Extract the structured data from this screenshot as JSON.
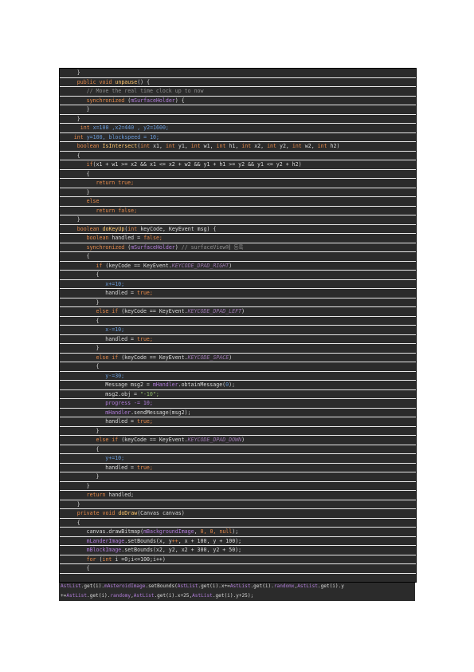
{
  "colors": {
    "background": "#2b2b2b",
    "keyword": "#e4894a",
    "method": "#ffc66d",
    "field": "#b07cd8",
    "constant": "#9876aa",
    "comment": "#8c8c8c",
    "number": "#6a9bd8",
    "string": "#8fb86a",
    "text": "#d8d8d8"
  },
  "lines": [
    {
      "indent": 5,
      "tokens": [
        {
          "t": "}",
          "c": "pl"
        }
      ]
    },
    {
      "indent": 5,
      "tokens": [
        {
          "t": "public void ",
          "c": "kw"
        },
        {
          "t": "unpause",
          "c": "fn"
        },
        {
          "t": "() {",
          "c": "pl"
        }
      ]
    },
    {
      "indent": 8,
      "tokens": [
        {
          "t": "// Move the real time clock up to now",
          "c": "com"
        }
      ]
    },
    {
      "indent": 8,
      "tokens": [
        {
          "t": "synchronized ",
          "c": "kw"
        },
        {
          "t": "(",
          "c": "pl"
        },
        {
          "t": "mSurfaceHolder",
          "c": "fld"
        },
        {
          "t": ") {",
          "c": "pl"
        }
      ]
    },
    {
      "indent": 8,
      "tokens": [
        {
          "t": "}",
          "c": "pl"
        }
      ]
    },
    {
      "indent": 5,
      "tokens": [
        {
          "t": "}",
          "c": "pl"
        }
      ]
    },
    {
      "indent": 5,
      "tokens": [
        {
          "t": " int ",
          "c": "kw"
        },
        {
          "t": "x=100 ,x2=440 , y2=1600;",
          "c": "num"
        }
      ]
    },
    {
      "indent": 4,
      "tokens": [
        {
          "t": "int ",
          "c": "kw"
        },
        {
          "t": "y=100, blockspeed = 10;",
          "c": "num"
        }
      ]
    },
    {
      "indent": 5,
      "tokens": [
        {
          "t": "boolean ",
          "c": "kw"
        },
        {
          "t": "IsIntersect",
          "c": "fn"
        },
        {
          "t": "(",
          "c": "pl"
        },
        {
          "t": "int ",
          "c": "kw"
        },
        {
          "t": "x1, ",
          "c": "pl"
        },
        {
          "t": "int ",
          "c": "kw"
        },
        {
          "t": "y1, ",
          "c": "pl"
        },
        {
          "t": "int ",
          "c": "kw"
        },
        {
          "t": "w1, ",
          "c": "pl"
        },
        {
          "t": "int ",
          "c": "kw"
        },
        {
          "t": "h1, ",
          "c": "pl"
        },
        {
          "t": "int ",
          "c": "kw"
        },
        {
          "t": "x2, ",
          "c": "pl"
        },
        {
          "t": "int ",
          "c": "kw"
        },
        {
          "t": "y2, ",
          "c": "pl"
        },
        {
          "t": "int ",
          "c": "kw"
        },
        {
          "t": "w2, ",
          "c": "pl"
        },
        {
          "t": "int ",
          "c": "kw"
        },
        {
          "t": "h2)",
          "c": "pl"
        }
      ]
    },
    {
      "indent": 5,
      "tokens": [
        {
          "t": "{",
          "c": "pl"
        }
      ]
    },
    {
      "indent": 8,
      "tokens": [
        {
          "t": "if",
          "c": "kw"
        },
        {
          "t": "(x1 + w1 >= x2 && x1 <= x2 + w2 && y1 + h1 >= y2 && y1 <= y2 + h2)",
          "c": "pl"
        }
      ]
    },
    {
      "indent": 8,
      "tokens": [
        {
          "t": "{",
          "c": "pl"
        }
      ]
    },
    {
      "indent": 11,
      "tokens": [
        {
          "t": "return true;",
          "c": "kw"
        }
      ]
    },
    {
      "indent": 8,
      "tokens": [
        {
          "t": "}",
          "c": "pl"
        }
      ]
    },
    {
      "indent": 8,
      "tokens": [
        {
          "t": "else",
          "c": "kw"
        }
      ]
    },
    {
      "indent": 11,
      "tokens": [
        {
          "t": "return false;",
          "c": "kw"
        }
      ]
    },
    {
      "indent": 5,
      "tokens": [
        {
          "t": "}",
          "c": "pl"
        }
      ]
    },
    {
      "indent": 5,
      "tokens": [
        {
          "t": "boolean ",
          "c": "kw"
        },
        {
          "t": "doKeyUp",
          "c": "fn"
        },
        {
          "t": "(",
          "c": "pl"
        },
        {
          "t": "int ",
          "c": "kw"
        },
        {
          "t": "keyCode, KeyEvent msg) {",
          "c": "pl"
        }
      ]
    },
    {
      "indent": 8,
      "tokens": [
        {
          "t": "boolean ",
          "c": "kw"
        },
        {
          "t": "handled = ",
          "c": "pl"
        },
        {
          "t": "false;",
          "c": "kw"
        }
      ]
    },
    {
      "indent": 8,
      "tokens": [
        {
          "t": "synchronized ",
          "c": "kw"
        },
        {
          "t": "(",
          "c": "pl"
        },
        {
          "t": "mSurfaceHolder",
          "c": "fld"
        },
        {
          "t": ") ",
          "c": "pl"
        },
        {
          "t": "// surfaceView에 등록",
          "c": "com"
        }
      ]
    },
    {
      "indent": 8,
      "tokens": [
        {
          "t": "{",
          "c": "pl"
        }
      ]
    },
    {
      "indent": 11,
      "tokens": [
        {
          "t": "if ",
          "c": "kw"
        },
        {
          "t": "(keyCode == KeyEvent.",
          "c": "pl"
        },
        {
          "t": "KEYCODE_DPAD_RIGHT",
          "c": "cst"
        },
        {
          "t": ")",
          "c": "pl"
        }
      ]
    },
    {
      "indent": 11,
      "tokens": [
        {
          "t": "{",
          "c": "pl"
        }
      ]
    },
    {
      "indent": 14,
      "tokens": [
        {
          "t": "x+=10;",
          "c": "num"
        }
      ]
    },
    {
      "indent": 14,
      "tokens": [
        {
          "t": "handled = ",
          "c": "pl"
        },
        {
          "t": "true;",
          "c": "kw"
        }
      ]
    },
    {
      "indent": 11,
      "tokens": [
        {
          "t": "}",
          "c": "pl"
        }
      ]
    },
    {
      "indent": 11,
      "tokens": [
        {
          "t": "else if ",
          "c": "kw"
        },
        {
          "t": "(keyCode == KeyEvent.",
          "c": "pl"
        },
        {
          "t": "KEYCODE_DPAD_LEFT",
          "c": "cst"
        },
        {
          "t": ")",
          "c": "pl"
        }
      ]
    },
    {
      "indent": 11,
      "tokens": [
        {
          "t": "{",
          "c": "pl"
        }
      ]
    },
    {
      "indent": 14,
      "tokens": [
        {
          "t": "x-=10;",
          "c": "num"
        }
      ]
    },
    {
      "indent": 14,
      "tokens": [
        {
          "t": "handled = ",
          "c": "pl"
        },
        {
          "t": "true;",
          "c": "kw"
        }
      ]
    },
    {
      "indent": 11,
      "tokens": [
        {
          "t": "}",
          "c": "pl"
        }
      ]
    },
    {
      "indent": 11,
      "tokens": [
        {
          "t": "else if ",
          "c": "kw"
        },
        {
          "t": "(keyCode == KeyEvent.",
          "c": "pl"
        },
        {
          "t": "KEYCODE_SPACE",
          "c": "cst"
        },
        {
          "t": ")",
          "c": "pl"
        }
      ]
    },
    {
      "indent": 11,
      "tokens": [
        {
          "t": "{",
          "c": "pl"
        }
      ]
    },
    {
      "indent": 14,
      "tokens": [
        {
          "t": "y-=30;",
          "c": "num"
        }
      ]
    },
    {
      "indent": 14,
      "tokens": [
        {
          "t": "Message msg2 = ",
          "c": "pl"
        },
        {
          "t": "mHandler",
          "c": "fld"
        },
        {
          "t": ".obtainMessage(",
          "c": "pl"
        },
        {
          "t": "0",
          "c": "num"
        },
        {
          "t": ");",
          "c": "pl"
        }
      ]
    },
    {
      "indent": 14,
      "tokens": [
        {
          "t": "msg2.obj = ",
          "c": "pl"
        },
        {
          "t": "\"-10\";",
          "c": "str"
        }
      ]
    },
    {
      "indent": 14,
      "tokens": [
        {
          "t": "progress -= 10;",
          "c": "fld"
        }
      ]
    },
    {
      "indent": 14,
      "tokens": [
        {
          "t": "mHandler",
          "c": "fld"
        },
        {
          "t": ".sendMessage(msg2);",
          "c": "pl"
        }
      ]
    },
    {
      "indent": 14,
      "tokens": [
        {
          "t": "handled = ",
          "c": "pl"
        },
        {
          "t": "true;",
          "c": "kw"
        }
      ]
    },
    {
      "indent": 11,
      "tokens": [
        {
          "t": "}",
          "c": "pl"
        }
      ]
    },
    {
      "indent": 11,
      "tokens": [
        {
          "t": "else if ",
          "c": "kw"
        },
        {
          "t": "(keyCode == KeyEvent.",
          "c": "pl"
        },
        {
          "t": "KEYCODE_DPAD_DOWN",
          "c": "cst"
        },
        {
          "t": ")",
          "c": "pl"
        }
      ]
    },
    {
      "indent": 11,
      "tokens": [
        {
          "t": "{",
          "c": "pl"
        }
      ]
    },
    {
      "indent": 14,
      "tokens": [
        {
          "t": "y+=10;",
          "c": "num"
        }
      ]
    },
    {
      "indent": 14,
      "tokens": [
        {
          "t": "handled = ",
          "c": "pl"
        },
        {
          "t": "true;",
          "c": "kw"
        }
      ]
    },
    {
      "indent": 11,
      "tokens": [
        {
          "t": "}",
          "c": "pl"
        }
      ]
    },
    {
      "indent": 8,
      "tokens": [
        {
          "t": "}",
          "c": "pl"
        }
      ]
    },
    {
      "indent": 8,
      "tokens": [
        {
          "t": "return ",
          "c": "kw"
        },
        {
          "t": "handled;",
          "c": "pl"
        }
      ]
    },
    {
      "indent": 5,
      "tokens": [
        {
          "t": "}",
          "c": "pl"
        }
      ]
    },
    {
      "indent": 5,
      "tokens": [
        {
          "t": "private void ",
          "c": "kw"
        },
        {
          "t": "doDraw",
          "c": "fn"
        },
        {
          "t": "(Canvas canvas)",
          "c": "pl"
        }
      ]
    },
    {
      "indent": 5,
      "tokens": [
        {
          "t": "{",
          "c": "pl"
        }
      ]
    },
    {
      "indent": 8,
      "tokens": [
        {
          "t": "canvas.drawBitmap(",
          "c": "pl"
        },
        {
          "t": "mBackgroundImage",
          "c": "fld"
        },
        {
          "t": ", ",
          "c": "pl"
        },
        {
          "t": "0, 0, null",
          "c": "kw"
        },
        {
          "t": ");",
          "c": "pl"
        }
      ]
    },
    {
      "indent": 8,
      "tokens": [
        {
          "t": "mLanderImage",
          "c": "fld"
        },
        {
          "t": ".setBounds(x, y",
          "c": "pl"
        },
        {
          "t": "++",
          "c": "kw"
        },
        {
          "t": ", x + 100, y + 100);",
          "c": "pl"
        }
      ]
    },
    {
      "indent": 8,
      "tokens": [
        {
          "t": "mBlockImage",
          "c": "fld"
        },
        {
          "t": ".setBounds(x2, y2, x2 + 300, y2 + 50);",
          "c": "pl"
        }
      ]
    },
    {
      "indent": 8,
      "tokens": [
        {
          "t": "for ",
          "c": "kw"
        },
        {
          "t": "(",
          "c": "pl"
        },
        {
          "t": "int ",
          "c": "kw"
        },
        {
          "t": "i =0;i<=100;i++)",
          "c": "pl"
        }
      ]
    },
    {
      "indent": 8,
      "tokens": [
        {
          "t": "{",
          "c": "pl"
        }
      ]
    },
    {
      "indent": 0,
      "tokens": [
        {
          "t": "",
          "c": "pl"
        }
      ]
    }
  ],
  "overflow": [
    {
      "tokens": [
        {
          "t": "AstList",
          "c": "fld"
        },
        {
          "t": ".get(i).",
          "c": "pl"
        },
        {
          "t": "mAsteroidImage",
          "c": "fld"
        },
        {
          "t": ".setBounds(",
          "c": "pl"
        },
        {
          "t": "AstList",
          "c": "fld"
        },
        {
          "t": ".get(i).x+=",
          "c": "pl"
        },
        {
          "t": "AstList",
          "c": "fld"
        },
        {
          "t": ".get(i).",
          "c": "pl"
        },
        {
          "t": "randomx",
          "c": "fld"
        },
        {
          "t": ",",
          "c": "pl"
        },
        {
          "t": "AstList",
          "c": "fld"
        },
        {
          "t": ".get(i).y",
          "c": "pl"
        }
      ]
    },
    {
      "tokens": [
        {
          "t": "+=",
          "c": "pl"
        },
        {
          "t": "AstList",
          "c": "fld"
        },
        {
          "t": ".get(i).",
          "c": "pl"
        },
        {
          "t": "randomy",
          "c": "fld"
        },
        {
          "t": ",",
          "c": "pl"
        },
        {
          "t": "AstList",
          "c": "fld"
        },
        {
          "t": ".get(i).x+25,",
          "c": "pl"
        },
        {
          "t": "AstList",
          "c": "fld"
        },
        {
          "t": ".get(i).y+25);",
          "c": "pl"
        }
      ]
    }
  ]
}
